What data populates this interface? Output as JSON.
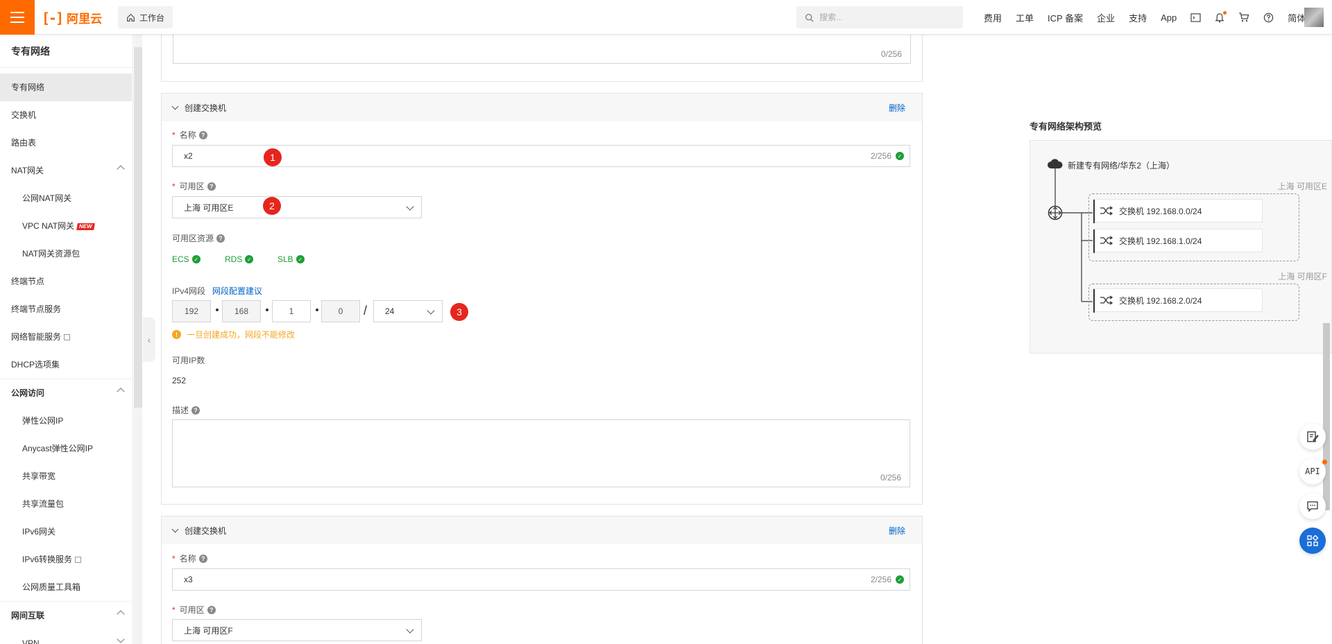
{
  "brand": {
    "logo_mark": "[-]",
    "logo_text": "阿里云",
    "orange": "#ff6a00"
  },
  "topbar": {
    "workbench": "工作台",
    "search_placeholder": "搜索...",
    "nav": [
      "费用",
      "工单",
      "ICP 备案",
      "企业",
      "支持",
      "App"
    ],
    "lang": "简体",
    "icons": [
      "terminal-icon",
      "bell-icon",
      "cart-icon",
      "help-icon"
    ]
  },
  "sidebar": {
    "title": "专有网络",
    "items": [
      {
        "label": "专有网络",
        "type": "item",
        "active": true
      },
      {
        "label": "交换机",
        "type": "item"
      },
      {
        "label": "路由表",
        "type": "item"
      },
      {
        "label": "NAT网关",
        "type": "item",
        "expand": true
      },
      {
        "label": "公网NAT网关",
        "type": "sub"
      },
      {
        "label": "VPC NAT网关",
        "type": "sub",
        "badge": "NEW"
      },
      {
        "label": "NAT网关资源包",
        "type": "sub"
      },
      {
        "label": "终端节点",
        "type": "item"
      },
      {
        "label": "终端节点服务",
        "type": "item"
      },
      {
        "label": "网络智能服务",
        "type": "item",
        "external": true
      },
      {
        "label": "DHCP选项集",
        "type": "item"
      },
      {
        "label": "公网访问",
        "type": "group",
        "expand": true
      },
      {
        "label": "弹性公网IP",
        "type": "sub"
      },
      {
        "label": "Anycast弹性公网IP",
        "type": "sub"
      },
      {
        "label": "共享带宽",
        "type": "sub"
      },
      {
        "label": "共享流量包",
        "type": "sub"
      },
      {
        "label": "IPv6网关",
        "type": "sub"
      },
      {
        "label": "IPv6转换服务",
        "type": "sub",
        "external": true
      },
      {
        "label": "公网质量工具箱",
        "type": "sub"
      },
      {
        "label": "网间互联",
        "type": "group",
        "expand": true
      },
      {
        "label": "VPN",
        "type": "sub"
      }
    ]
  },
  "form": {
    "top_count": "0/256",
    "panel1": {
      "header": "创建交换机",
      "delete": "删除",
      "name_label": "名称",
      "name_value": "x2",
      "name_count": "2/256",
      "zone_label": "可用区",
      "zone_value": "上海 可用区E",
      "resources_label": "可用区资源",
      "resources": [
        "ECS",
        "RDS",
        "SLB"
      ],
      "ipv4_label": "IPv4网段",
      "ipv4_link": "网段配置建议",
      "ip": [
        "192",
        "168",
        "1",
        "0"
      ],
      "slash": "/",
      "mask": "24",
      "warning": "一旦创建成功，网段不能修改",
      "available_ip_label": "可用IP数",
      "available_ip_value": "252",
      "desc_label": "描述",
      "desc_count": "0/256"
    },
    "panel2": {
      "header": "创建交换机",
      "delete": "删除",
      "name_label": "名称",
      "name_value": "x3",
      "name_count": "2/256",
      "zone_label": "可用区",
      "zone_value": "上海 可用区F"
    },
    "markers": [
      "1",
      "2",
      "3"
    ]
  },
  "preview": {
    "title": "专有网络架构预览",
    "vpc": "新建专有网络/华东2（上海）",
    "zones": [
      {
        "label": "上海 可用区E",
        "switches": [
          "交换机 192.168.0.0/24",
          "交换机 192.168.1.0/24"
        ]
      },
      {
        "label": "上海 可用区F",
        "switches": [
          "交换机 192.168.2.0/24"
        ]
      }
    ]
  },
  "fabs": {
    "api": "API"
  }
}
